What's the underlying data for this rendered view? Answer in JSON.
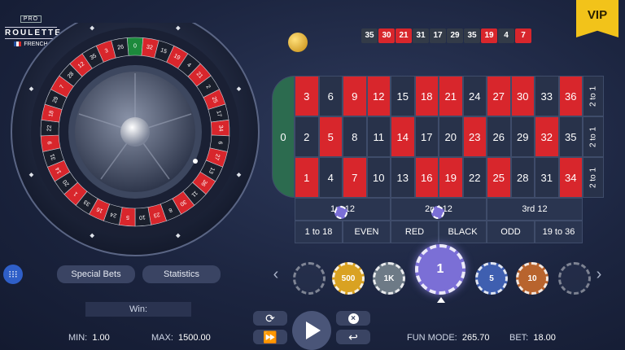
{
  "logo": {
    "pro": "PRO",
    "name": "ROULETTE",
    "language": "FRENCH"
  },
  "vip": "VIP",
  "history": [
    {
      "n": "35",
      "c": "black"
    },
    {
      "n": "30",
      "c": "red"
    },
    {
      "n": "21",
      "c": "red"
    },
    {
      "n": "31",
      "c": "black"
    },
    {
      "n": "17",
      "c": "black"
    },
    {
      "n": "29",
      "c": "black"
    },
    {
      "n": "35",
      "c": "black"
    },
    {
      "n": "19",
      "c": "red"
    },
    {
      "n": "4",
      "c": "black"
    },
    {
      "n": "7",
      "c": "red"
    }
  ],
  "table": {
    "zero": "0",
    "rows": [
      [
        {
          "n": "3",
          "c": "red"
        },
        {
          "n": "6",
          "c": "black"
        },
        {
          "n": "9",
          "c": "red"
        },
        {
          "n": "12",
          "c": "red"
        },
        {
          "n": "15",
          "c": "black"
        },
        {
          "n": "18",
          "c": "red"
        },
        {
          "n": "21",
          "c": "red"
        },
        {
          "n": "24",
          "c": "black"
        },
        {
          "n": "27",
          "c": "red"
        },
        {
          "n": "30",
          "c": "red"
        },
        {
          "n": "33",
          "c": "black"
        },
        {
          "n": "36",
          "c": "red"
        }
      ],
      [
        {
          "n": "2",
          "c": "black"
        },
        {
          "n": "5",
          "c": "red"
        },
        {
          "n": "8",
          "c": "black"
        },
        {
          "n": "11",
          "c": "black"
        },
        {
          "n": "14",
          "c": "red"
        },
        {
          "n": "17",
          "c": "black"
        },
        {
          "n": "20",
          "c": "black"
        },
        {
          "n": "23",
          "c": "red"
        },
        {
          "n": "26",
          "c": "black"
        },
        {
          "n": "29",
          "c": "black"
        },
        {
          "n": "32",
          "c": "red"
        },
        {
          "n": "35",
          "c": "black"
        }
      ],
      [
        {
          "n": "1",
          "c": "red"
        },
        {
          "n": "4",
          "c": "black"
        },
        {
          "n": "7",
          "c": "red"
        },
        {
          "n": "10",
          "c": "black"
        },
        {
          "n": "13",
          "c": "black"
        },
        {
          "n": "16",
          "c": "red"
        },
        {
          "n": "19",
          "c": "red"
        },
        {
          "n": "22",
          "c": "black"
        },
        {
          "n": "25",
          "c": "red"
        },
        {
          "n": "28",
          "c": "black"
        },
        {
          "n": "31",
          "c": "black"
        },
        {
          "n": "34",
          "c": "red"
        }
      ]
    ],
    "column_bets": [
      "2 to 1",
      "2 to 1",
      "2 to 1"
    ],
    "dozens": [
      "1st 12",
      "2nd 12",
      "3rd 12"
    ],
    "outside": [
      "1 to 18",
      "EVEN",
      "RED",
      "BLACK",
      "ODD",
      "19 to 36"
    ]
  },
  "wheel_numbers": [
    "0",
    "32",
    "15",
    "19",
    "4",
    "21",
    "2",
    "25",
    "17",
    "34",
    "6",
    "27",
    "13",
    "36",
    "11",
    "30",
    "8",
    "23",
    "10",
    "5",
    "24",
    "16",
    "33",
    "1",
    "20",
    "14",
    "31",
    "9",
    "22",
    "18",
    "29",
    "7",
    "28",
    "12",
    "35",
    "3",
    "26"
  ],
  "chips": [
    {
      "label": "",
      "color": "#2b3551"
    },
    {
      "label": "500",
      "color": "#d9a222"
    },
    {
      "label": "1K",
      "color": "#6d7a86"
    },
    {
      "label": "1",
      "color": "#7b6fd6",
      "selected": true
    },
    {
      "label": "5",
      "color": "#3f5fb0"
    },
    {
      "label": "10",
      "color": "#b8642e"
    },
    {
      "label": "",
      "color": "#2b3551"
    }
  ],
  "buttons": {
    "special_bets": "Special Bets",
    "statistics": "Statistics"
  },
  "win_label": "Win:",
  "footer": {
    "min_label": "MIN:",
    "min_value": "1.00",
    "max_label": "MAX:",
    "max_value": "1500.00",
    "mode_label": "FUN MODE:",
    "mode_value": "265.70",
    "bet_label": "BET:",
    "bet_value": "18.00"
  },
  "colors": {
    "red": "#d8262c",
    "black": "#28324a",
    "green": "#1c8a3c",
    "gold": "#f2c31a",
    "chip_selected": "#7b6fd6"
  }
}
